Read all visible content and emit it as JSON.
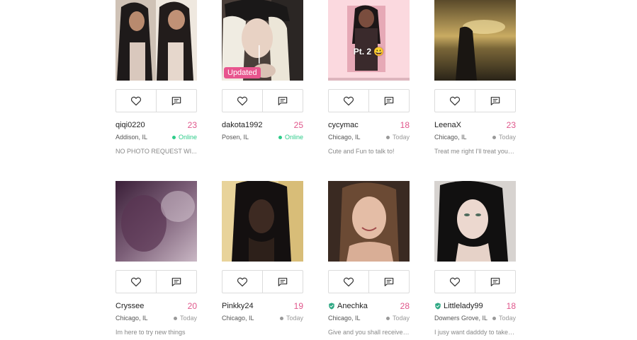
{
  "colors": {
    "age": "#e0568b",
    "online": "#2ecc8a",
    "badge": "#e8558e"
  },
  "profiles": [
    {
      "username": "qiqi0220",
      "age": "23",
      "location": "Addison, IL",
      "status": "Online",
      "bio": "NO PHOTO REQUEST WI...",
      "verified": false
    },
    {
      "username": "dakota1992",
      "age": "25",
      "location": "Posen, IL",
      "status": "Online",
      "bio": "",
      "verified": false,
      "badge": "Updated"
    },
    {
      "username": "cycymac",
      "age": "18",
      "location": "Chicago, IL",
      "status": "Today",
      "bio": "Cute and Fun to talk to!",
      "verified": false,
      "photo_text": "Pt. 2 😀"
    },
    {
      "username": "LeenaX",
      "age": "23",
      "location": "Chicago, IL",
      "status": "Today",
      "bio": "Treat me right I'll treat you b...",
      "verified": false
    },
    {
      "username": "Cryssee",
      "age": "20",
      "location": "Chicago, IL",
      "status": "Today",
      "bio": "Im here to try new things",
      "verified": false
    },
    {
      "username": "Pinkky24",
      "age": "19",
      "location": "Chicago, IL",
      "status": "Today",
      "bio": "",
      "verified": false
    },
    {
      "username": "Anechka",
      "age": "28",
      "location": "Chicago, IL",
      "status": "Today",
      "bio": "Give and you shall receive ...",
      "verified": true
    },
    {
      "username": "Littlelady99",
      "age": "18",
      "location": "Downers Grove, IL",
      "status": "Today",
      "bio": "I jusy want dadddy to take c...",
      "verified": true
    }
  ],
  "icons": {
    "like": "heart-icon",
    "message": "message-icon",
    "verified": "verified-shield-icon"
  }
}
